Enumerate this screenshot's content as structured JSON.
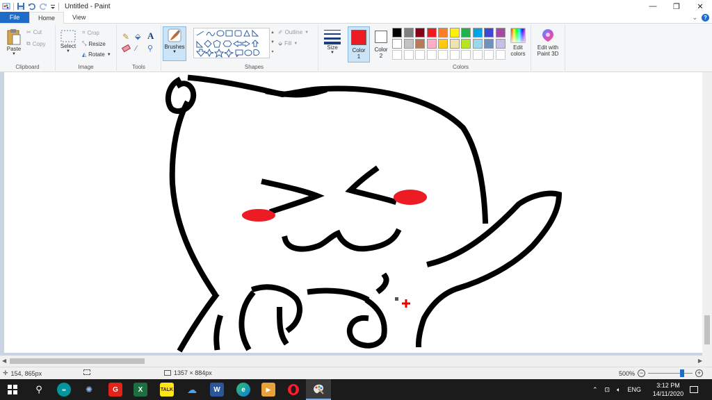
{
  "window": {
    "title": "Untitled - Paint",
    "minimize": "—",
    "restore": "❐",
    "close": "✕"
  },
  "tabs": [
    {
      "label": "File"
    },
    {
      "label": "Home"
    },
    {
      "label": "View"
    }
  ],
  "ribbon": {
    "clipboard": {
      "label": "Clipboard",
      "paste": "Paste",
      "cut": "Cut",
      "copy": "Copy"
    },
    "image": {
      "label": "Image",
      "select": "Select",
      "crop": "Crop",
      "resize": "Resize",
      "rotate": "Rotate"
    },
    "tools": {
      "label": "Tools"
    },
    "brushes": {
      "label": "Brushes"
    },
    "shapes": {
      "label": "Shapes",
      "outline": "Outline",
      "fill": "Fill"
    },
    "size": {
      "label": "Size"
    },
    "color1": {
      "label": "Color",
      "num": "1",
      "value": "#ed1c24"
    },
    "color2": {
      "label": "Color",
      "num": "2",
      "value": "#ffffff"
    },
    "colors": {
      "label": "Colors",
      "row1": [
        "#000000",
        "#7f7f7f",
        "#880015",
        "#ed1c24",
        "#ff7f27",
        "#fff200",
        "#22b14c",
        "#00a2e8",
        "#3f48cc",
        "#a349a4"
      ],
      "row2": [
        "#ffffff",
        "#c3c3c3",
        "#b97a57",
        "#ffaec9",
        "#ffc90e",
        "#efe4b0",
        "#b5e61d",
        "#99d9ea",
        "#7092be",
        "#c8bfe7"
      ],
      "edit_label_1": "Edit",
      "edit_label_2": "colors"
    },
    "paint3d": {
      "label_1": "Edit with",
      "label_2": "Paint 3D"
    }
  },
  "status": {
    "cursor_pos": "154, 865px",
    "canvas_size": "1357 × 884px",
    "zoom": "500%"
  },
  "taskbar": {
    "lang": "ENG",
    "time": "3:12 PM",
    "date": "14/11/2020",
    "icons": [
      "windows-start",
      "search",
      "arduino",
      "network-app",
      "g-app",
      "excel",
      "kakaotalk",
      "onedrive",
      "word",
      "edge",
      "media-player",
      "opera",
      "paint"
    ]
  }
}
